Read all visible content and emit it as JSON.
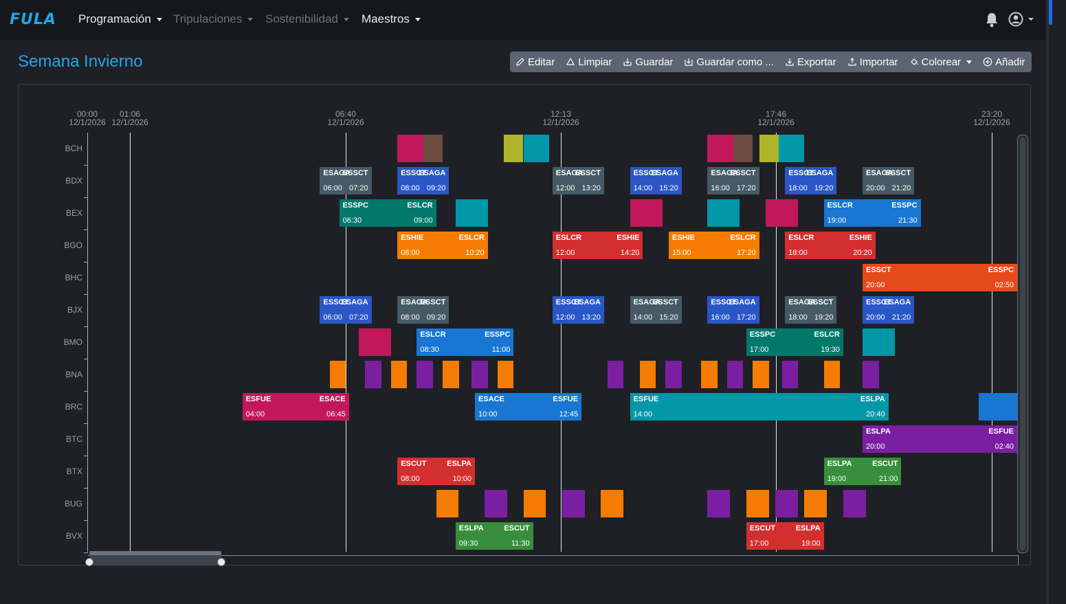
{
  "brand": "FULA",
  "nav": {
    "programacion": "Programación",
    "tripulaciones": "Tripulaciones",
    "sostenibilidad": "Sostenibilidad",
    "maestros": "Maestros"
  },
  "page_title": "Semana Invierno",
  "toolbar": {
    "editar": "Editar",
    "limpiar": "Limpiar",
    "guardar": "Guardar",
    "guardar_como": "Guardar como ...",
    "exportar": "Exportar",
    "importar": "Importar",
    "colorear": "Colorear",
    "anadir": "Añadir"
  },
  "colors": {
    "accent": "#22a6e8",
    "gray": "#455a64",
    "blue": "#2a56c6",
    "teal": "#00796b",
    "cyan": "#0097a7",
    "pink": "#c2185b",
    "brown": "#6d4c41",
    "olive": "#afb42b",
    "orange": "#f57c00",
    "red": "#d32f2f",
    "deeporange": "#e64a19",
    "lightblue": "#1976d2",
    "purple": "#7b1fa2",
    "green": "#388e3c"
  },
  "timeline": {
    "ticks": [
      {
        "time": "00:00",
        "date": "12/1/2026"
      },
      {
        "time": "01:06",
        "date": "12/1/2026"
      },
      {
        "time": "06:40",
        "date": "12/1/2026"
      },
      {
        "time": "12:13",
        "date": "12/1/2026"
      },
      {
        "time": "17:46",
        "date": "12/1/2026"
      },
      {
        "time": "23:20",
        "date": "12/1/2026"
      }
    ],
    "rows": [
      "BCH",
      "BDX",
      "BEX",
      "BGO",
      "BHC",
      "BJX",
      "BMO",
      "BNA",
      "BRC",
      "BTC",
      "BTX",
      "BUG",
      "BVX"
    ],
    "flights": [
      {
        "row": 1,
        "origin": "ESAGA",
        "dest": "ESSCT",
        "dep": "06:00",
        "arr": "07:20",
        "color": "gray"
      },
      {
        "row": 1,
        "origin": "ESSCT",
        "dest": "ESAGA",
        "dep": "08:00",
        "arr": "09:20",
        "color": "blue"
      },
      {
        "row": 1,
        "origin": "ESAGA",
        "dest": "ESSCT",
        "dep": "12:00",
        "arr": "13:20",
        "color": "gray"
      },
      {
        "row": 1,
        "origin": "ESSCT",
        "dest": "ESAGA",
        "dep": "14:00",
        "arr": "15:20",
        "color": "blue"
      },
      {
        "row": 1,
        "origin": "ESAGA",
        "dest": "ESSCT",
        "dep": "16:00",
        "arr": "17:20",
        "color": "gray"
      },
      {
        "row": 1,
        "origin": "ESSCT",
        "dest": "ESAGA",
        "dep": "18:00",
        "arr": "19:20",
        "color": "blue"
      },
      {
        "row": 1,
        "origin": "ESAGA",
        "dest": "ESSCT",
        "dep": "20:00",
        "arr": "21:20",
        "color": "gray"
      },
      {
        "row": 2,
        "origin": "ESSPC",
        "dest": "ESLCR",
        "dep": "06:30",
        "arr": "09:00",
        "color": "teal"
      },
      {
        "row": 2,
        "origin": "ESLCR",
        "dest": "ESSPC",
        "dep": "19:00",
        "arr": "21:30",
        "color": "lightblue"
      },
      {
        "row": 3,
        "origin": "ESHIE",
        "dest": "ESLCR",
        "dep": "08:00",
        "arr": "10:20",
        "color": "orange"
      },
      {
        "row": 3,
        "origin": "ESLCR",
        "dest": "ESHIE",
        "dep": "12:00",
        "arr": "14:20",
        "color": "red"
      },
      {
        "row": 3,
        "origin": "ESHIE",
        "dest": "ESLCR",
        "dep": "15:00",
        "arr": "17:20",
        "color": "orange"
      },
      {
        "row": 3,
        "origin": "ESLCR",
        "dest": "ESHIE",
        "dep": "18:00",
        "arr": "20:20",
        "color": "red"
      },
      {
        "row": 4,
        "origin": "ESSCT",
        "dest": "ESSPC",
        "dep": "20:00",
        "arr": "02:50",
        "color": "deeporange"
      },
      {
        "row": 5,
        "origin": "ESSCT",
        "dest": "ESAGA",
        "dep": "06:00",
        "arr": "07:20",
        "color": "blue"
      },
      {
        "row": 5,
        "origin": "ESAGA",
        "dest": "ESSCT",
        "dep": "08:00",
        "arr": "09:20",
        "color": "gray"
      },
      {
        "row": 5,
        "origin": "ESSCT",
        "dest": "ESAGA",
        "dep": "12:00",
        "arr": "13:20",
        "color": "blue"
      },
      {
        "row": 5,
        "origin": "ESAGA",
        "dest": "ESSCT",
        "dep": "14:00",
        "arr": "15:20",
        "color": "gray"
      },
      {
        "row": 5,
        "origin": "ESSCT",
        "dest": "ESAGA",
        "dep": "16:00",
        "arr": "17:20",
        "color": "blue"
      },
      {
        "row": 5,
        "origin": "ESAGA",
        "dest": "ESSCT",
        "dep": "18:00",
        "arr": "19:20",
        "color": "gray"
      },
      {
        "row": 5,
        "origin": "ESSCT",
        "dest": "ESAGA",
        "dep": "20:00",
        "arr": "21:20",
        "color": "blue"
      },
      {
        "row": 6,
        "origin": "ESLCR",
        "dest": "ESSPC",
        "dep": "08:30",
        "arr": "11:00",
        "color": "lightblue"
      },
      {
        "row": 6,
        "origin": "ESSPC",
        "dest": "ESLCR",
        "dep": "17:00",
        "arr": "19:30",
        "color": "teal"
      },
      {
        "row": 8,
        "origin": "ESFUE",
        "dest": "ESACE",
        "dep": "04:00",
        "arr": "06:45",
        "color": "pink"
      },
      {
        "row": 8,
        "origin": "ESACE",
        "dest": "ESFUE",
        "dep": "10:00",
        "arr": "12:45",
        "color": "lightblue"
      },
      {
        "row": 8,
        "origin": "ESFUE",
        "dest": "ESLPA",
        "dep": "14:00",
        "arr": "20:40",
        "color": "cyan"
      },
      {
        "row": 9,
        "origin": "ESLPA",
        "dest": "ESFUE",
        "dep": "20:00",
        "arr": "02:40",
        "color": "purple"
      },
      {
        "row": 10,
        "origin": "ESCUT",
        "dest": "ESLPA",
        "dep": "08:00",
        "arr": "10:00",
        "color": "red"
      },
      {
        "row": 10,
        "origin": "ESLPA",
        "dest": "ESCUT",
        "dep": "19:00",
        "arr": "21:00",
        "color": "green"
      },
      {
        "row": 12,
        "origin": "ESLPA",
        "dest": "ESCUT",
        "dep": "09:30",
        "arr": "11:30",
        "color": "green"
      },
      {
        "row": 12,
        "origin": "ESCUT",
        "dest": "ESLPA",
        "dep": "17:00",
        "arr": "19:00",
        "color": "red"
      }
    ],
    "blocks": [
      {
        "row": 0,
        "start": "08:00",
        "end": "08:40",
        "color": "pink"
      },
      {
        "row": 0,
        "start": "08:40",
        "end": "09:10",
        "color": "brown"
      },
      {
        "row": 0,
        "start": "10:45",
        "end": "11:15",
        "color": "olive"
      },
      {
        "row": 0,
        "start": "11:15",
        "end": "11:55",
        "color": "cyan"
      },
      {
        "row": 0,
        "start": "16:00",
        "end": "16:40",
        "color": "pink"
      },
      {
        "row": 0,
        "start": "16:40",
        "end": "17:10",
        "color": "brown"
      },
      {
        "row": 0,
        "start": "17:20",
        "end": "17:50",
        "color": "olive"
      },
      {
        "row": 0,
        "start": "17:50",
        "end": "18:30",
        "color": "cyan"
      },
      {
        "row": 2,
        "start": "09:30",
        "end": "10:20",
        "color": "cyan"
      },
      {
        "row": 2,
        "start": "14:00",
        "end": "14:50",
        "color": "pink"
      },
      {
        "row": 2,
        "start": "16:00",
        "end": "16:50",
        "color": "cyan"
      },
      {
        "row": 2,
        "start": "17:30",
        "end": "18:20",
        "color": "pink"
      },
      {
        "row": 6,
        "start": "07:00",
        "end": "07:50",
        "color": "pink"
      },
      {
        "row": 6,
        "start": "20:00",
        "end": "20:50",
        "color": "cyan"
      },
      {
        "row": 7,
        "start": "06:15",
        "end": "06:40",
        "color": "orange"
      },
      {
        "row": 7,
        "start": "07:10",
        "end": "07:35",
        "color": "purple"
      },
      {
        "row": 7,
        "start": "07:50",
        "end": "08:15",
        "color": "orange"
      },
      {
        "row": 7,
        "start": "08:30",
        "end": "08:55",
        "color": "purple"
      },
      {
        "row": 7,
        "start": "09:10",
        "end": "09:35",
        "color": "orange"
      },
      {
        "row": 7,
        "start": "09:55",
        "end": "10:20",
        "color": "purple"
      },
      {
        "row": 7,
        "start": "10:35",
        "end": "11:00",
        "color": "orange"
      },
      {
        "row": 7,
        "start": "13:25",
        "end": "13:50",
        "color": "purple"
      },
      {
        "row": 7,
        "start": "14:15",
        "end": "14:40",
        "color": "orange"
      },
      {
        "row": 7,
        "start": "14:55",
        "end": "15:20",
        "color": "purple"
      },
      {
        "row": 7,
        "start": "15:50",
        "end": "16:15",
        "color": "orange"
      },
      {
        "row": 7,
        "start": "16:30",
        "end": "16:55",
        "color": "purple"
      },
      {
        "row": 7,
        "start": "17:10",
        "end": "17:35",
        "color": "orange"
      },
      {
        "row": 7,
        "start": "17:55",
        "end": "18:20",
        "color": "purple"
      },
      {
        "row": 7,
        "start": "19:00",
        "end": "19:25",
        "color": "orange"
      },
      {
        "row": 7,
        "start": "20:00",
        "end": "20:25",
        "color": "purple"
      },
      {
        "row": 8,
        "start": "23:00",
        "end": "23:59",
        "color": "lightblue"
      },
      {
        "row": 11,
        "start": "09:00",
        "end": "09:35",
        "color": "orange"
      },
      {
        "row": 11,
        "start": "10:15",
        "end": "10:50",
        "color": "purple"
      },
      {
        "row": 11,
        "start": "11:15",
        "end": "11:50",
        "color": "orange"
      },
      {
        "row": 11,
        "start": "12:15",
        "end": "12:50",
        "color": "purple"
      },
      {
        "row": 11,
        "start": "13:15",
        "end": "13:50",
        "color": "orange"
      },
      {
        "row": 11,
        "start": "16:00",
        "end": "16:35",
        "color": "purple"
      },
      {
        "row": 11,
        "start": "17:00",
        "end": "17:35",
        "color": "orange"
      },
      {
        "row": 11,
        "start": "17:45",
        "end": "18:20",
        "color": "purple"
      },
      {
        "row": 11,
        "start": "18:30",
        "end": "19:05",
        "color": "orange"
      },
      {
        "row": 11,
        "start": "19:30",
        "end": "20:05",
        "color": "purple"
      }
    ]
  }
}
